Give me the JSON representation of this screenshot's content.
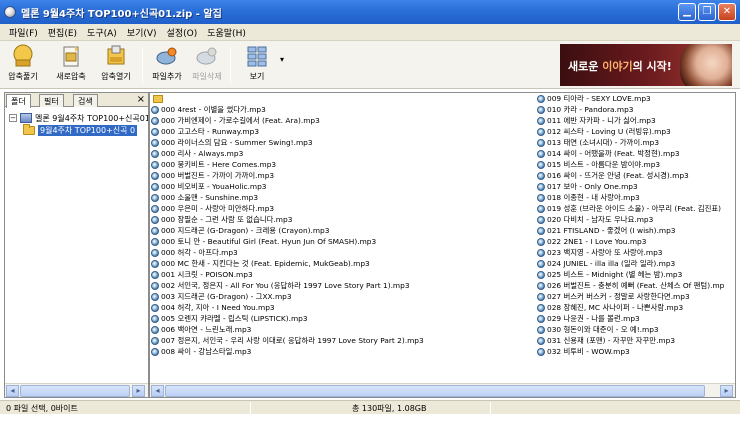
{
  "window": {
    "title": "멜론 9월4주차 TOP100+신곡01.zip - 알집"
  },
  "menu": [
    "파일(F)",
    "편집(E)",
    "도구(A)",
    "보기(V)",
    "설정(O)",
    "도움말(H)"
  ],
  "toolbar": {
    "compress": "압축풀기",
    "new_archive": "새로압축",
    "open_archive": "압축열기",
    "add_file": "파일추가",
    "delete_file": "파일삭제",
    "view": "보기",
    "view_dropdown": "▾"
  },
  "banner": {
    "text_a": "새로운 ",
    "text_b": "이야기",
    "text_c": "의 시작!"
  },
  "left": {
    "tabs": [
      "폴더",
      "필터",
      "검색"
    ],
    "close": "×",
    "tree_root": "멜론 9월4주차 TOP100+신곡01",
    "tree_child": "9월4주차 TOP100+신곡 0"
  },
  "files_left": [
    "000 4rest - 이별을 썼다가.mp3",
    "000 가비엔제이 - 가로수길에서 (Feat. Ara).mp3",
    "000 고고스타 - Runway.mp3",
    "000 라이너스의 담요 - Summer Swing!.mp3",
    "000 리사 - Always.mp3",
    "000 뭉키비트 - Here Comes.mp3",
    "000 버벌진트 - 가까이 가까이.mp3",
    "000 비오비포 - YouaHolic.mp3",
    "000 소울맨 - Sunshine.mp3",
    "000 우은미 - 사랑아 미안하다.mp3",
    "000 장필순 - 그런 사람 또 없습니다.mp3",
    "000 지드래곤 (G-Dragon) - 크레용 (Crayon).mp3",
    "000 토니 안 - Beautiful Girl (Feat. Hyun Jun Of SMASH).mp3",
    "000 허각 - 아프다.mp3",
    "000 MC 한새 - 지킨다는 것 (Feat. Epidemic, MukGeab).mp3",
    "001 시크릿 - POISON.mp3",
    "002 서인국, 정은지 - All For You (응답하라 1997 Love Story Part 1).mp3",
    "003 지드래곤 (G-Dragon) - 그XX.mp3",
    "004 허각, 지아 - I Need You.mp3",
    "005 오렌지 캬라멜 - 립스틱 (LIPSTICK).mp3",
    "006 백아연 - 느린노래.mp3",
    "007 정은지, 서인국 - 우리 사랑 이대로( 응답하라 1997 Love Story Part 2).mp3",
    "008 싸이 - 강남스타일.mp3"
  ],
  "files_right": [
    "009 티아라 - SEXY LOVE.mp3",
    "010 카라 - Pandora.mp3",
    "011 에반 자카파 - 니가 싫어.mp3",
    "012 씨스타 - Loving U (러빙유).mp3",
    "013 태연 (소녀시대) - 가까이.mp3",
    "014 싸이 - 어땠을까 (Feat. 박정현).mp3",
    "015 비스트 - 아름다운 밤이야.mp3",
    "016 싸이 - 뜨거운 안녕 (Feat. 성시경).mp3",
    "017 보아 - Only One.mp3",
    "018 이종현 - 내 사랑아.mp3",
    "019 성훈 (브라운 아이드 소울) - 아무리 (Feat. 김진표)",
    "020 다비치 - 남자도 우나요.mp3",
    "021 FTISLAND - 좋겠어 (I wish).mp3",
    "022 2NE1 - I Love You.mp3",
    "023 백지영 - 사랑아 또 사랑아.mp3",
    "024 JUNIEL - illa illa (일라 일라).mp3",
    "025 비스트 - Midnight (별 헤는 밤).mp3",
    "026 버벌진트 - 충분히 예뻐 (Feat. 산체스 Of 팬텀).mp",
    "027 버스커 버스커 - 정말로 사랑한다면.mp3",
    "028 장혜진, MC 사나이퍼 - 나쁜사람.mp3",
    "029 나윤권 - 나를 볼런.mp3",
    "030 형돈이와 대준이 - 오 예!.mp3",
    "031 신용재 (포맨) - 자꾸만 자꾸만.mp3",
    "032 비투비 - WOW.mp3"
  ],
  "status": {
    "selection": "0 파일 선택,  0바이트",
    "total": "총 130파일,  1.08GB"
  },
  "scroll": {
    "left": "◂",
    "right": "▸"
  }
}
